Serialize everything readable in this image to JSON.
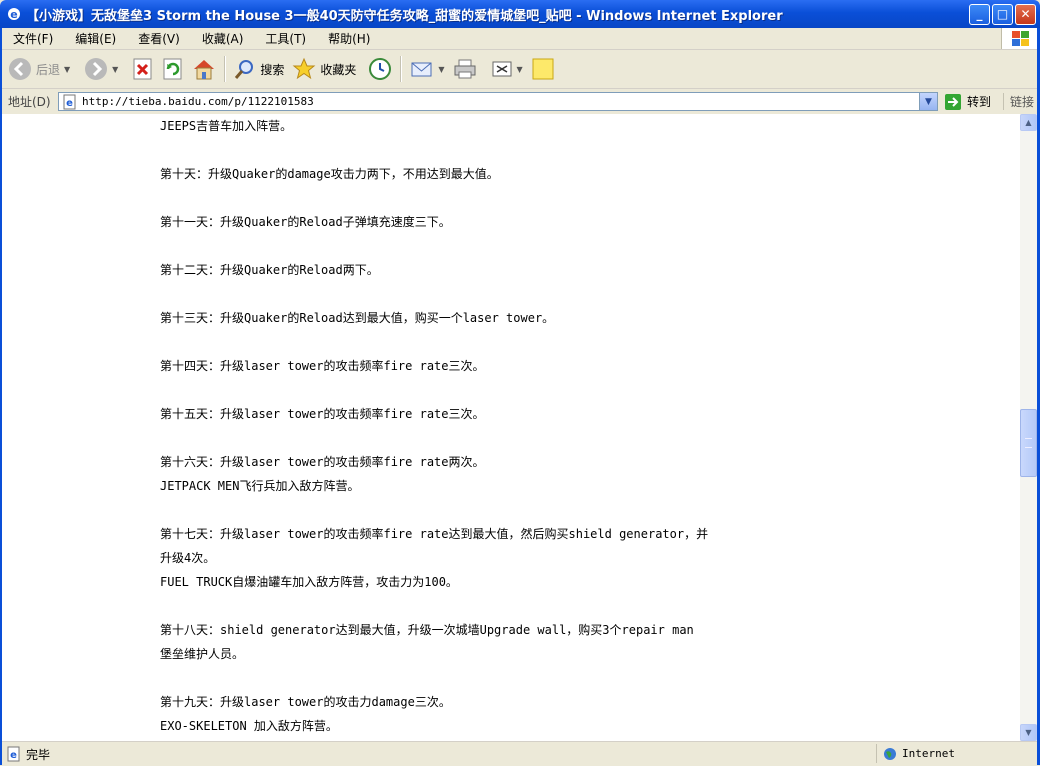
{
  "window": {
    "title": "【小游戏】无敌堡垒3 Storm the House 3一般40天防守任务攻略_甜蜜的爱情城堡吧_贴吧 - Windows Internet Explorer",
    "minimize": "_",
    "maximize": "□",
    "close": "✕"
  },
  "menu": {
    "items": [
      "文件(F)",
      "编辑(E)",
      "查看(V)",
      "收藏(A)",
      "工具(T)",
      "帮助(H)"
    ]
  },
  "toolbar": {
    "back_label": "后退",
    "search_label": "搜索",
    "favorites_label": "收藏夹"
  },
  "address": {
    "label": "地址(D)",
    "url": "http://tieba.baidu.com/p/1122101583",
    "go_label": "转到",
    "links_label": "链接"
  },
  "post": {
    "lines": [
      "JEEPS吉普车加入阵营。",
      "",
      "第十天：升级Quaker的damage攻击力两下，不用达到最大值。",
      "",
      "第十一天：升级Quaker的Reload子弹填充速度三下。",
      "",
      "第十二天：升级Quaker的Reload两下。",
      "",
      "第十三天：升级Quaker的Reload达到最大值，购买一个laser tower。",
      "",
      "第十四天：升级laser tower的攻击频率fire rate三次。",
      "",
      "第十五天：升级laser tower的攻击频率fire rate三次。",
      "",
      "第十六天：升级laser tower的攻击频率fire rate两次。",
      "JETPACK MEN飞行兵加入敌方阵营。",
      "",
      "第十七天：升级laser tower的攻击频率fire rate达到最大值，然后购买shield generator，并",
      "升级4次。",
      "FUEL TRUCK自爆油罐车加入敌方阵营，攻击力为100。",
      "",
      "第十八天：shield generator达到最大值，升级一次城墙Upgrade wall，购买3个repair man",
      "堡垒维护人员。",
      "",
      "第十九天：升级laser tower的攻击力damage三次。",
      "EXO-SKELETON 加入敌方阵营。"
    ]
  },
  "status": {
    "text": "完毕",
    "zone": "Internet"
  }
}
